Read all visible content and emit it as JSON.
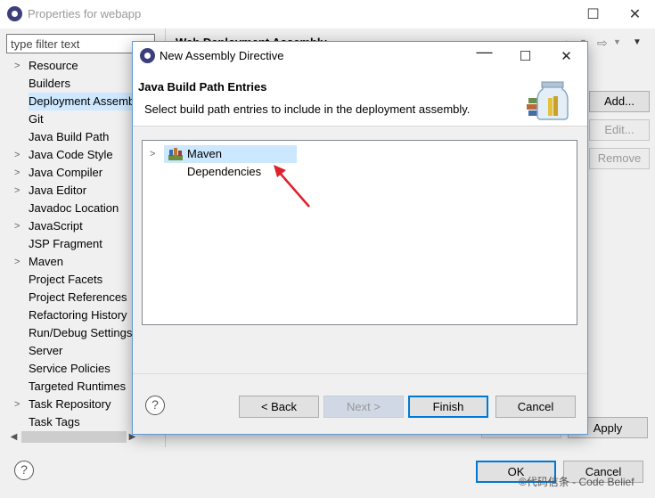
{
  "outer_window": {
    "title": "Properties for webapp",
    "filter_placeholder": "type filter text",
    "right_pane_header": "Web Deployment Assembly",
    "tree_items": [
      {
        "label": "Resource",
        "expandable": true
      },
      {
        "label": "Builders",
        "expandable": false
      },
      {
        "label": "Deployment Assembly",
        "expandable": false,
        "selected": true
      },
      {
        "label": "Git",
        "expandable": false
      },
      {
        "label": "Java Build Path",
        "expandable": false
      },
      {
        "label": "Java Code Style",
        "expandable": true
      },
      {
        "label": "Java Compiler",
        "expandable": true
      },
      {
        "label": "Java Editor",
        "expandable": true
      },
      {
        "label": "Javadoc Location",
        "expandable": false
      },
      {
        "label": "JavaScript",
        "expandable": true
      },
      {
        "label": "JSP Fragment",
        "expandable": false
      },
      {
        "label": "Maven",
        "expandable": true
      },
      {
        "label": "Project Facets",
        "expandable": false
      },
      {
        "label": "Project References",
        "expandable": false
      },
      {
        "label": "Refactoring History",
        "expandable": false
      },
      {
        "label": "Run/Debug Settings",
        "expandable": false
      },
      {
        "label": "Server",
        "expandable": false
      },
      {
        "label": "Service Policies",
        "expandable": false
      },
      {
        "label": "Targeted Runtimes",
        "expandable": false
      },
      {
        "label": "Task Repository",
        "expandable": true
      },
      {
        "label": "Task Tags",
        "expandable": false
      }
    ],
    "side_buttons": {
      "add": "Add...",
      "edit": "Edit...",
      "remove": "Remove"
    },
    "apply_label": "Apply",
    "ok_label": "OK",
    "cancel_label": "Cancel",
    "watermark": "©代码信条 - Code Belief"
  },
  "dialog": {
    "title": "New Assembly Directive",
    "header_title": "Java Build Path Entries",
    "header_description": "Select build path entries to include in the deployment assembly.",
    "entries": [
      {
        "label": "Maven Dependencies",
        "icon": "library-icon",
        "selected": true
      }
    ],
    "buttons": {
      "back": "< Back",
      "next": "Next >",
      "finish": "Finish",
      "cancel": "Cancel"
    }
  },
  "colors": {
    "selection": "#cce8ff",
    "dialog_border": "#5c9bd6",
    "annotation_arrow": "#e0202a",
    "primary_button_border": "#0078d7"
  }
}
